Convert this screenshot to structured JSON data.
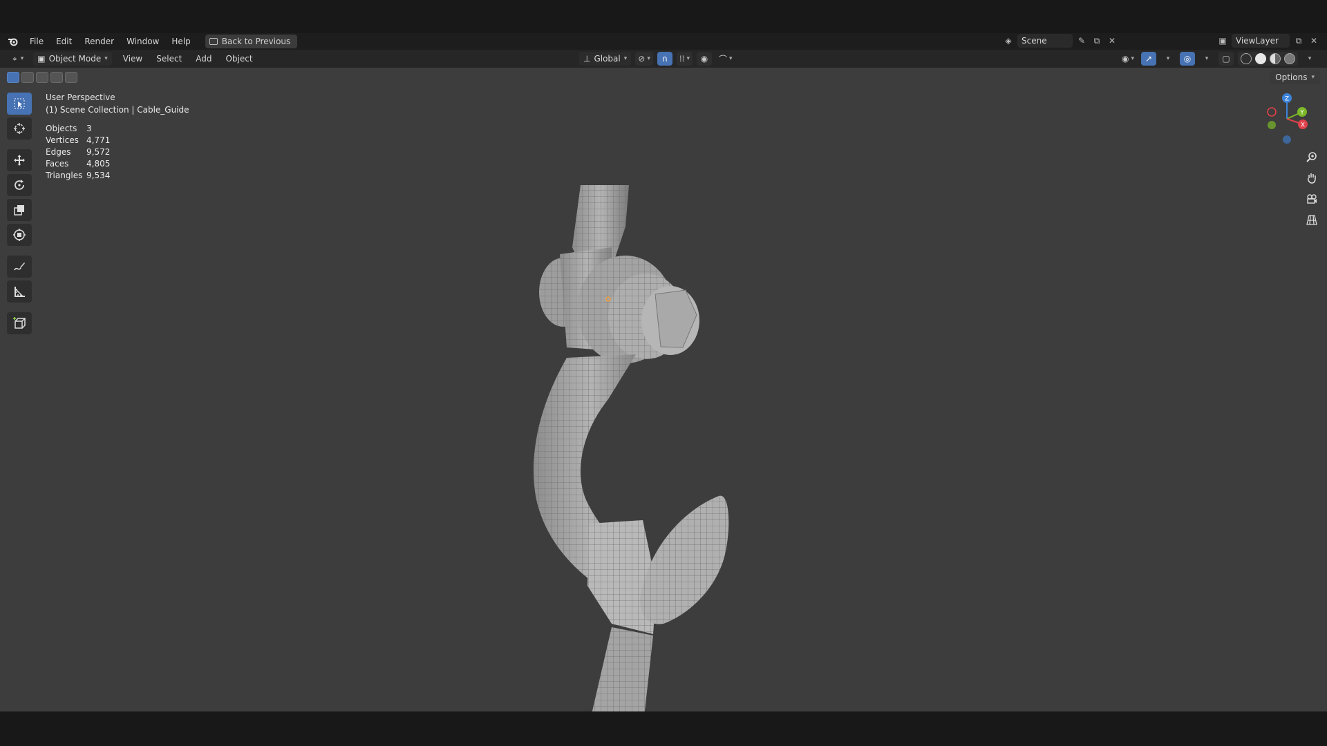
{
  "topbar": {
    "menu": [
      "File",
      "Edit",
      "Render",
      "Window",
      "Help"
    ],
    "back_button": "Back to Previous",
    "scene": "Scene",
    "view_layer": "ViewLayer"
  },
  "header": {
    "mode": "Object Mode",
    "menu": [
      "View",
      "Select",
      "Add",
      "Object"
    ],
    "orientation": "Global"
  },
  "viewport": {
    "options_label": "Options",
    "perspective": "User Perspective",
    "collection": "(1) Scene Collection | Cable_Guide",
    "stats": [
      {
        "label": "Objects",
        "value": "3"
      },
      {
        "label": "Vertices",
        "value": "4,771"
      },
      {
        "label": "Edges",
        "value": "9,572"
      },
      {
        "label": "Faces",
        "value": "4,805"
      },
      {
        "label": "Triangles",
        "value": "9,534"
      }
    ],
    "gizmo_axes": {
      "x": "X",
      "y": "Y",
      "z": "Z"
    }
  },
  "colors": {
    "accent": "#4772b3",
    "axis_x": "#e0414a",
    "axis_y": "#7cb828",
    "axis_z": "#3d83d9",
    "viewport_bg": "#3d3d3d"
  },
  "icons": {
    "toolbar": [
      "select-box-icon",
      "cursor-icon",
      "move-icon",
      "rotate-icon",
      "scale-icon",
      "transform-icon",
      "annotate-icon",
      "measure-icon",
      "add-cube-icon"
    ],
    "nav": [
      "zoom-icon",
      "pan-hand-icon",
      "camera-icon",
      "ortho-grid-icon"
    ]
  }
}
